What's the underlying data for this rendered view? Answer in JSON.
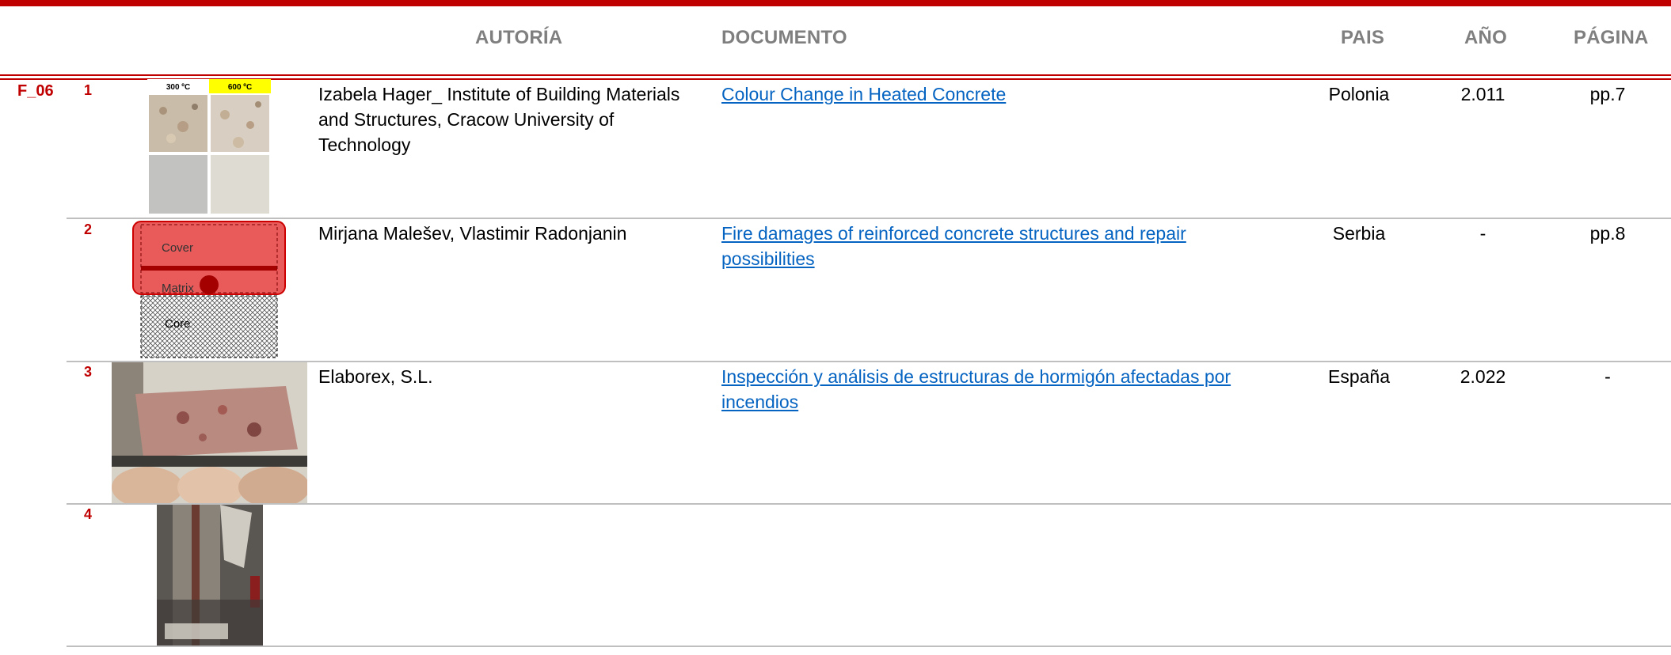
{
  "headers": {
    "autoria": "AUTORÍA",
    "documento": "DOCUMENTO",
    "pais": "PAIS",
    "ano": "AÑO",
    "pagina": "PÁGINA"
  },
  "section_ref": "F_06",
  "colors": {
    "accent": "#c00000",
    "link": "#0563c1",
    "header_text": "#7f7f7f"
  },
  "rows": [
    {
      "num": "1",
      "author": "Izabela Hager_ Institute of Building Materials and Structures, Cracow University of Technology",
      "document": "Colour Change in Heated Concrete",
      "country": "Polonia",
      "year": "2.011",
      "page": "pp.7",
      "image": {
        "label_left": "300 ºC",
        "label_right": "600 ºC"
      }
    },
    {
      "num": "2",
      "author": "Mirjana Malešev, Vlastimir Radonjanin",
      "document": "Fire damages of reinforced concrete structures and repair possibilities",
      "country": "Serbia",
      "year": "-",
      "page": "pp.8",
      "image": {
        "label_cover": "Cover",
        "label_matrix": "Matrix",
        "label_core": "Core"
      }
    },
    {
      "num": "3",
      "author": "Elaborex, S.L.",
      "document": "Inspección y análisis de estructuras de hormigón afectadas por incendios",
      "country": "España",
      "year": "2.022",
      "page": "-"
    },
    {
      "num": "4",
      "author": "",
      "document": "",
      "country": "",
      "year": "",
      "page": ""
    }
  ]
}
